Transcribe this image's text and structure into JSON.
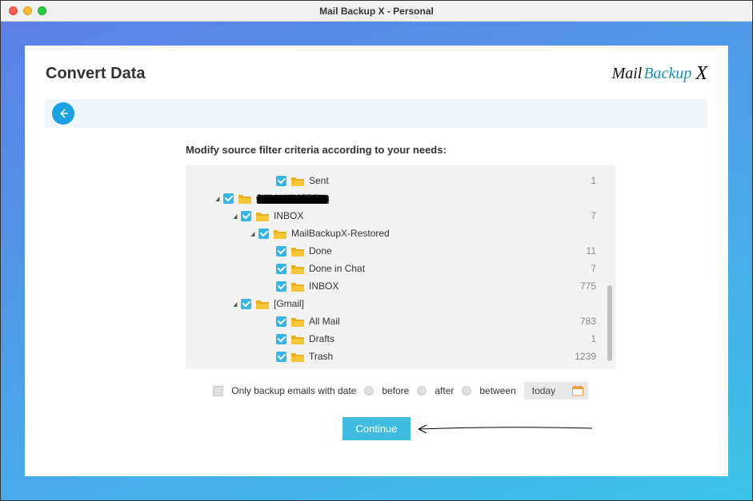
{
  "window": {
    "title": "Mail Backup X - Personal"
  },
  "logo": {
    "mail": "Mail",
    "backup": "Backup",
    "x": "X"
  },
  "page": {
    "title": "Convert Data"
  },
  "instruction": "Modify source filter criteria according to your needs:",
  "folders": [
    {
      "indent": 3,
      "expanded": null,
      "label": "Sent",
      "count": "1"
    },
    {
      "indent": 0,
      "expanded": true,
      "label": "__redacted__",
      "count": ""
    },
    {
      "indent": 1,
      "expanded": true,
      "label": "INBOX",
      "count": "7"
    },
    {
      "indent": 2,
      "expanded": true,
      "label": "MailBackupX-Restored",
      "count": ""
    },
    {
      "indent": 3,
      "expanded": null,
      "label": "Done",
      "count": "11"
    },
    {
      "indent": 3,
      "expanded": null,
      "label": "Done in Chat",
      "count": "7"
    },
    {
      "indent": 3,
      "expanded": null,
      "label": "INBOX",
      "count": "775"
    },
    {
      "indent": 1,
      "expanded": true,
      "label": "[Gmail]",
      "count": ""
    },
    {
      "indent": 3,
      "expanded": null,
      "label": "All Mail",
      "count": "783"
    },
    {
      "indent": 3,
      "expanded": null,
      "label": "Drafts",
      "count": "1"
    },
    {
      "indent": 3,
      "expanded": null,
      "label": "Trash",
      "count": "1239"
    }
  ],
  "filter": {
    "only_backup_label": "Only backup emails with date",
    "before": "before",
    "after": "after",
    "between": "between",
    "date_value": "today"
  },
  "continue_label": "Continue"
}
